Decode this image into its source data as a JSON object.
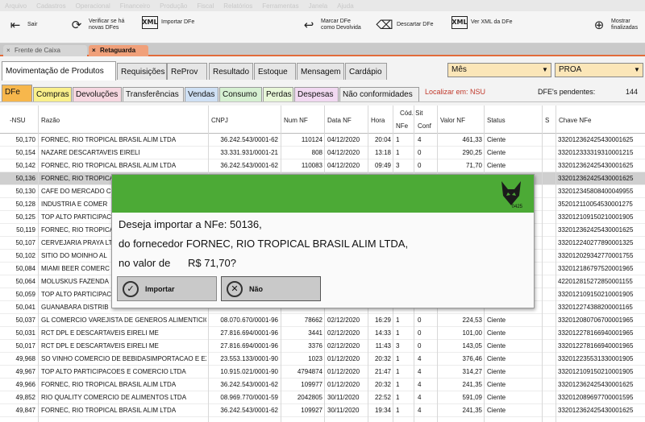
{
  "menubar": [
    "Arquivo",
    "Cadastros",
    "Operacional",
    "Financeiro",
    "Produção",
    "Fiscal",
    "Relatórios",
    "Ferramentas",
    "Janela",
    "Ajuda"
  ],
  "toolbar": {
    "sair": "Sair",
    "verificar": [
      "Verificar se há",
      "novas DFes"
    ],
    "importar": "Importar DFe",
    "marcar": [
      "Marcar DFe",
      "como Devolvida"
    ],
    "descartar": "Descartar DFe",
    "verxml": "Ver XML da DFe",
    "mostrar": [
      "Mostrar",
      "finalizadas"
    ]
  },
  "window_tabs": [
    "Frente de Caixa",
    "Retaguarda"
  ],
  "main_tabs": [
    "Movimentação de Produtos",
    "Requisições",
    "ReProv",
    "Resultado",
    "Estoque",
    "Mensagem",
    "Cardápio"
  ],
  "combo_period": "Mês",
  "combo_company": "PROA",
  "sub_tabs": [
    "DFe",
    "Compras",
    "Devoluções",
    "Transferências",
    "Vendas",
    "Consumo",
    "Perdas",
    "Despesas",
    "Não conformidades"
  ],
  "localizar": "Localizar em: NSU",
  "pendentes_label": "DFE's pendentes:",
  "pendentes_value": "144",
  "columns": {
    "nsu": "-NSU",
    "razao": "Razão",
    "cnpj": "CNPJ",
    "numnf": "Num NF",
    "datanf": "Data NF",
    "hora": "Hora",
    "codsit": "Cód. Sit",
    "nfe": "NFe",
    "conf": "Conf",
    "valor": "Valor NF",
    "status": "Status",
    "s": "S",
    "chave": "Chave NFe"
  },
  "rows": [
    {
      "nsu": "50,170",
      "razao": "FORNEC, RIO TROPICAL BRASIL  ALIM LTDA",
      "cnpj": "36.242.543/0001-62",
      "num": "110124",
      "data": "04/12/2020",
      "hora": "20:04",
      "nfe": "1",
      "conf": "4",
      "valor": "461,33",
      "status": "Ciente",
      "chave": "332012362425430001625"
    },
    {
      "nsu": "50,154",
      "razao": "NAZARE DESCARTAVEIS EIRELI",
      "cnpj": "33.331.931/0001-21",
      "num": "808",
      "data": "04/12/2020",
      "hora": "13:18",
      "nfe": "1",
      "conf": "0",
      "valor": "290,25",
      "status": "Ciente",
      "chave": "332012333319310001215"
    },
    {
      "nsu": "50,142",
      "razao": "FORNEC, RIO TROPICAL BRASIL  ALIM LTDA",
      "cnpj": "36.242.543/0001-62",
      "num": "110083",
      "data": "04/12/2020",
      "hora": "09:49",
      "nfe": "3",
      "conf": "0",
      "valor": "71,70",
      "status": "Ciente",
      "chave": "332012362425430001625"
    },
    {
      "nsu": "50,136",
      "razao": "FORNEC, RIO TROPICAL",
      "cnpj": "",
      "num": "",
      "data": "",
      "hora": "",
      "nfe": "",
      "conf": "",
      "valor": "",
      "status": "",
      "chave": "332012362425430001625"
    },
    {
      "nsu": "50,130",
      "razao": "CAFE DO MERCADO C",
      "cnpj": "",
      "num": "",
      "data": "",
      "hora": "",
      "nfe": "",
      "conf": "",
      "valor": "",
      "status": "",
      "chave": "332012345808400049955"
    },
    {
      "nsu": "50,128",
      "razao": "INDUSTRIA E COMER",
      "cnpj": "",
      "num": "",
      "data": "",
      "hora": "",
      "nfe": "",
      "conf": "",
      "valor": "",
      "status": "",
      "chave": "352012110054530001275"
    },
    {
      "nsu": "50,125",
      "razao": "TOP ALTO PARTICIPAC",
      "cnpj": "",
      "num": "",
      "data": "",
      "hora": "",
      "nfe": "",
      "conf": "",
      "valor": "",
      "status": "",
      "chave": "332012109150210001905"
    },
    {
      "nsu": "50,119",
      "razao": "FORNEC, RIO TROPICAL",
      "cnpj": "",
      "num": "",
      "data": "",
      "hora": "",
      "nfe": "",
      "conf": "",
      "valor": "",
      "status": "",
      "chave": "332012362425430001625"
    },
    {
      "nsu": "50,107",
      "razao": "CERVEJARIA PRAYA LT",
      "cnpj": "",
      "num": "",
      "data": "",
      "hora": "",
      "nfe": "",
      "conf": "",
      "valor": "",
      "status": "",
      "chave": "332012240277890001325"
    },
    {
      "nsu": "50,102",
      "razao": "SITIO DO MOINHO AL",
      "cnpj": "",
      "num": "",
      "data": "",
      "hora": "",
      "nfe": "",
      "conf": "",
      "valor": "",
      "status": "",
      "chave": "332012029342770001755"
    },
    {
      "nsu": "50,084",
      "razao": "MIAMI BEER COMERC",
      "cnpj": "",
      "num": "",
      "data": "",
      "hora": "",
      "nfe": "",
      "conf": "",
      "valor": "",
      "status": "",
      "chave": "332012186797520001965"
    },
    {
      "nsu": "50,064",
      "razao": "MOLUSKUS FAZENDA",
      "cnpj": "",
      "num": "",
      "data": "",
      "hora": "",
      "nfe": "",
      "conf": "",
      "valor": "",
      "status": "",
      "chave": "422012815272850001155"
    },
    {
      "nsu": "50,059",
      "razao": "TOP ALTO PARTICIPAC",
      "cnpj": "",
      "num": "",
      "data": "",
      "hora": "",
      "nfe": "",
      "conf": "",
      "valor": "",
      "status": "",
      "chave": "332012109150210001905"
    },
    {
      "nsu": "50,041",
      "razao": "GUANABARA DISTRIB",
      "cnpj": "",
      "num": "",
      "data": "",
      "hora": "",
      "nfe": "",
      "conf": "",
      "valor": "",
      "status": "",
      "chave": "332012274388200001165"
    },
    {
      "nsu": "50,037",
      "razao": "GL COMERCIO VAREJISTA DE GENEROS ALIMENTICIOS",
      "cnpj": "08.070.670/0001-96",
      "num": "78662",
      "data": "02/12/2020",
      "hora": "16:29",
      "nfe": "1",
      "conf": "0",
      "valor": "224,53",
      "status": "Ciente",
      "chave": "332012080706700001965"
    },
    {
      "nsu": "50,031",
      "razao": "RCT DPL E DESCARTAVEIS EIRELI ME",
      "cnpj": "27.816.694/0001-96",
      "num": "3441",
      "data": "02/12/2020",
      "hora": "14:33",
      "nfe": "1",
      "conf": "0",
      "valor": "101,00",
      "status": "Ciente",
      "chave": "332012278166940001965"
    },
    {
      "nsu": "50,017",
      "razao": "RCT DPL E DESCARTAVEIS EIRELI ME",
      "cnpj": "27.816.694/0001-96",
      "num": "3376",
      "data": "02/12/2020",
      "hora": "11:43",
      "nfe": "3",
      "conf": "0",
      "valor": "143,05",
      "status": "Ciente",
      "chave": "332012278166940001965"
    },
    {
      "nsu": "49,968",
      "razao": "SO VINHO COMERCIO DE BEBIDASIMPORTACAO E EXPORTACAO",
      "cnpj": "23.553.133/0001-90",
      "num": "1023",
      "data": "01/12/2020",
      "hora": "20:32",
      "nfe": "1",
      "conf": "4",
      "valor": "376,46",
      "status": "Ciente",
      "chave": "332012235531330001905"
    },
    {
      "nsu": "49,967",
      "razao": "TOP ALTO PARTICIPACOES E COMERCIO LTDA",
      "cnpj": "10.915.021/0001-90",
      "num": "4794874",
      "data": "01/12/2020",
      "hora": "21:47",
      "nfe": "1",
      "conf": "4",
      "valor": "314,27",
      "status": "Ciente",
      "chave": "332012109150210001905"
    },
    {
      "nsu": "49,966",
      "razao": "FORNEC, RIO TROPICAL BRASIL  ALIM LTDA",
      "cnpj": "36.242.543/0001-62",
      "num": "109977",
      "data": "01/12/2020",
      "hora": "20:32",
      "nfe": "1",
      "conf": "4",
      "valor": "241,35",
      "status": "Ciente",
      "chave": "332012362425430001625"
    },
    {
      "nsu": "49,852",
      "razao": "RIO QUALITY COMERCIO DE ALIMENTOS LTDA",
      "cnpj": "08.969.770/0001-59",
      "num": "2042805",
      "data": "30/11/2020",
      "hora": "22:52",
      "nfe": "1",
      "conf": "4",
      "valor": "591,09",
      "status": "Ciente",
      "chave": "332012089697700001595"
    },
    {
      "nsu": "49,847",
      "razao": "FORNEC, RIO TROPICAL BRASIL  ALIM LTDA",
      "cnpj": "36.242.543/0001-62",
      "num": "109927",
      "data": "30/11/2020",
      "hora": "19:34",
      "nfe": "1",
      "conf": "4",
      "valor": "241,35",
      "status": "Ciente",
      "chave": "332012362425430001625"
    }
  ],
  "dialog": {
    "line1": "Deseja importar a NFe: 50136,",
    "line2": "do fornecedor FORNEC, RIO TROPICAL BRASIL  ALIM LTDA,",
    "line3": "no valor de      R$ 71,70?",
    "logo_text": "0425",
    "btn_import": "Importar",
    "btn_no": "Não"
  },
  "colors": {
    "accent": "#e26b3a",
    "dialog_header": "#4caa36",
    "localizar": "#c0392b"
  }
}
